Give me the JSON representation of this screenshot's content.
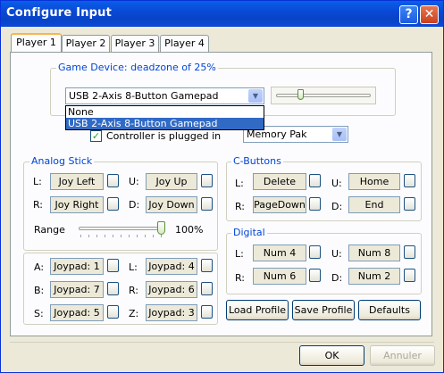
{
  "window": {
    "title": "Configure Input",
    "help_glyph": "?",
    "close_glyph": "✕"
  },
  "tabs": [
    {
      "label": "Player 1"
    },
    {
      "label": "Player 2"
    },
    {
      "label": "Player 3"
    },
    {
      "label": "Player 4"
    }
  ],
  "game_device": {
    "legend": "Game Device: deadzone of 25%",
    "selected": "USB 2-Axis 8-Button Gamepad",
    "options": [
      "None",
      "USB 2-Axis 8-Button Gamepad"
    ],
    "deadzone_fraction": 0.25
  },
  "plugged": {
    "label": "Controller is plugged in",
    "checked": true
  },
  "pak": {
    "selected": "Memory Pak"
  },
  "analog": {
    "legend": "Analog Stick",
    "rows": [
      {
        "left_label": "L:",
        "left_value": "Joy Left",
        "right_label": "U:",
        "right_value": "Joy Up"
      },
      {
        "left_label": "R:",
        "left_value": "Joy Right",
        "right_label": "D:",
        "right_value": "Joy Down"
      }
    ],
    "range_label": "Range",
    "range_value": "100%",
    "range_fraction": 1.0
  },
  "cbuttons": {
    "legend": "C-Buttons",
    "rows": [
      {
        "left_label": "L:",
        "left_value": "Delete",
        "right_label": "U:",
        "right_value": "Home"
      },
      {
        "left_label": "R:",
        "left_value": "PageDown",
        "right_label": "D:",
        "right_value": "End"
      }
    ]
  },
  "digital": {
    "legend": "Digital",
    "rows": [
      {
        "left_label": "L:",
        "left_value": "Num 4",
        "right_label": "U:",
        "right_value": "Num 8"
      },
      {
        "left_label": "R:",
        "left_value": "Num 6",
        "right_label": "D:",
        "right_value": "Num 2"
      }
    ]
  },
  "buttons": {
    "rows": [
      {
        "left_label": "A:",
        "left_value": "Joypad: 1",
        "right_label": "L:",
        "right_value": "Joypad: 4"
      },
      {
        "left_label": "B:",
        "left_value": "Joypad: 7",
        "right_label": "R:",
        "right_value": "Joypad: 6"
      },
      {
        "left_label": "S:",
        "left_value": "Joypad: 5",
        "right_label": "Z:",
        "right_value": "Joypad: 3"
      }
    ]
  },
  "actions": {
    "load": "Load Profile",
    "save": "Save Profile",
    "defaults": "Defaults"
  },
  "footer": {
    "ok": "OK",
    "cancel": "Annuler"
  }
}
